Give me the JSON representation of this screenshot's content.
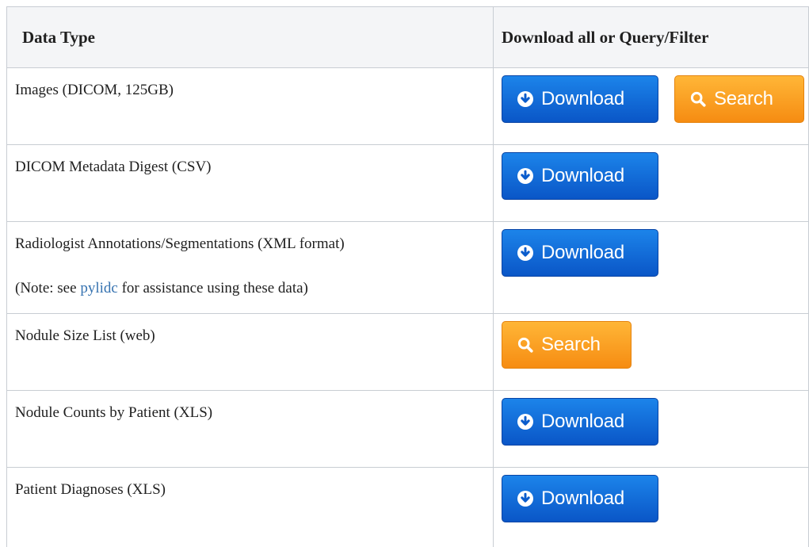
{
  "table": {
    "headers": [
      "Data Type",
      "Download all or Query/Filter"
    ],
    "rows": [
      {
        "label": "Images (DICOM, 125GB)"
      },
      {
        "label": "DICOM Metadata Digest (CSV)"
      },
      {
        "label": "Radiologist Annotations/Segmentations (XML format)",
        "note_prefix": "(Note: see ",
        "note_link": "pylidc",
        "note_suffix": " for assistance using these data)"
      },
      {
        "label": "Nodule Size List (web)"
      },
      {
        "label": "Nodule Counts by Patient (XLS)"
      },
      {
        "label": "Patient Diagnoses (XLS)"
      }
    ]
  },
  "buttons": {
    "download": "Download",
    "search": "Search"
  },
  "icons": {
    "download": "circle-arrow-down-icon",
    "search": "magnifier-icon"
  },
  "colors": {
    "download": "#1269d8",
    "search": "#f9a021",
    "link": "#3572b0",
    "header_bg": "#f4f5f7",
    "border": "#c8cdd3"
  }
}
